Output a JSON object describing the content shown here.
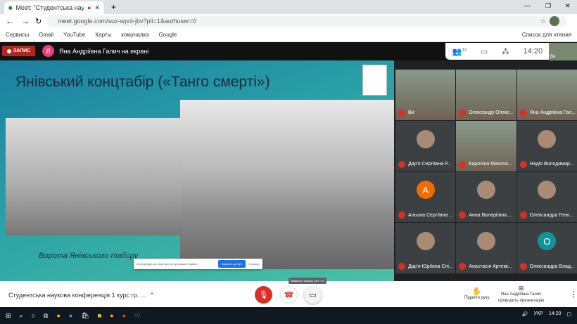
{
  "browser": {
    "tab_title": "Meet: \"Студентська науков",
    "url": "meet.google.com/suz-wpni-jbv?pli=1&authuser=0",
    "bookmarks": [
      "Сервисы",
      "Gmail",
      "YouTube",
      "Карты",
      "комуналка",
      "Google"
    ],
    "reading_list": "Список для чтения"
  },
  "meet": {
    "record_label": "ЗАПИС",
    "presenter_initial": "Я",
    "presenting_text": "Яна Андріївна Галич на екрані",
    "participants_count": "12",
    "time": "14:20",
    "self_label": "Ви"
  },
  "slide": {
    "title": "Янівський концтабір («Танго смерті»)",
    "caption": "Ворота Янівського табору",
    "share_notice": "meet.google.com має доступ до вашого екрана",
    "stop_sharing": "Закрити доступ",
    "hide": "Сховати"
  },
  "participants": [
    {
      "name": "Ви",
      "video": true
    },
    {
      "name": "Олександр Олекс...",
      "video": true
    },
    {
      "name": "Яна Андріївна Гал...",
      "video": true
    },
    {
      "name": "Дар'я Сергіївна Р...",
      "avatar": "photo"
    },
    {
      "name": "Кароліна Микола...",
      "video": true
    },
    {
      "name": "Надія Володимир...",
      "avatar": "photo"
    },
    {
      "name": "Альона Сергіївна ...",
      "avatar": "А",
      "color": "#ef6c00"
    },
    {
      "name": "Анна Валеріївна ...",
      "avatar": "photo"
    },
    {
      "name": "Олександра Генн...",
      "avatar": "photo"
    },
    {
      "name": "Дар'я Юріївна Спі...",
      "avatar": "photo"
    },
    {
      "name": "Анастасія Артемі...",
      "avatar": "photo"
    },
    {
      "name": "Олександра Влад...",
      "avatar": "О",
      "color": "#12939a"
    }
  ],
  "bottom": {
    "meeting_name": "Студентська наукова конференція 1 курс гр. ...",
    "camera_tooltip": "Вимкнути камеру (ctrl + e)",
    "raise_hand": "Підняти руку",
    "presenting_line1": "Яна Андріївна Галич",
    "presenting_line2": "проводить презентацію"
  },
  "taskbar": {
    "lang": "УКР",
    "time": "14:20"
  }
}
